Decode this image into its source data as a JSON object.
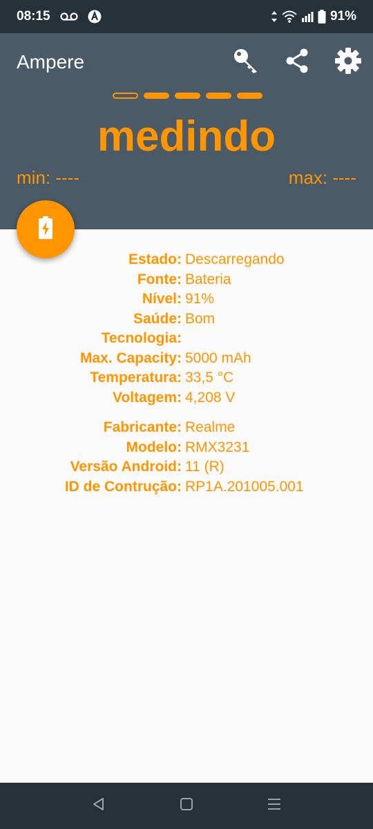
{
  "status_bar": {
    "time": "08:15",
    "battery_percent": "91%",
    "icons": [
      "voicemail-icon",
      "a-badge-icon",
      "data-arrows-icon",
      "wifi-icon",
      "signal-icon",
      "battery-icon"
    ]
  },
  "header": {
    "title": "Ampere",
    "actions": [
      "key-icon",
      "share-icon",
      "gear-icon"
    ],
    "status_text": "medindo",
    "progress_dots": {
      "total": 5,
      "filled": 4
    },
    "min_label": "min: ----",
    "max_label": "max: ----"
  },
  "fab": {
    "icon": "battery-charging-icon"
  },
  "battery_info": [
    {
      "label": "Estado:",
      "value": "Descarregando"
    },
    {
      "label": "Fonte:",
      "value": "Bateria"
    },
    {
      "label": "Nível:",
      "value": "91%"
    },
    {
      "label": "Saúde:",
      "value": "Bom"
    },
    {
      "label": "Tecnologia:",
      "value": ""
    },
    {
      "label": "Max. Capacity:",
      "value": "5000 mAh"
    },
    {
      "label": "Temperatura:",
      "value": "33,5 °C"
    },
    {
      "label": "Voltagem:",
      "value": "4,208 V"
    }
  ],
  "device_info": [
    {
      "label": "Fabricante:",
      "value": "Realme"
    },
    {
      "label": "Modelo:",
      "value": "RMX3231"
    },
    {
      "label": "Versão Android:",
      "value": "11 (R)"
    },
    {
      "label": "ID de Contrução:",
      "value": "RP1A.201005.001"
    }
  ],
  "nav_bar": {
    "buttons": [
      "back-icon",
      "home-icon",
      "recents-icon"
    ]
  },
  "colors": {
    "accent": "#ff9500",
    "header_bg": "#4a5a66",
    "system_bar": "#263238",
    "content_bg": "#fafafa"
  }
}
